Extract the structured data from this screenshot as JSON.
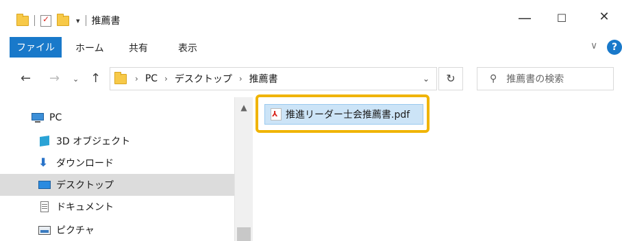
{
  "window": {
    "title": "推薦書",
    "controls": {
      "minimize": "—",
      "maximize": "☐",
      "close": "✕"
    }
  },
  "ribbon": {
    "tabs": [
      "ファイル",
      "ホーム",
      "共有",
      "表示"
    ],
    "help": "?"
  },
  "address": {
    "crumbs": [
      "PC",
      "デスクトップ",
      "推薦書"
    ],
    "search_placeholder": "推薦書の検索"
  },
  "nav_pane": {
    "items": [
      {
        "label": "PC",
        "icon": "pc-icon"
      },
      {
        "label": "3D オブジェクト",
        "icon": "3d-objects-icon"
      },
      {
        "label": "ダウンロード",
        "icon": "download-icon"
      },
      {
        "label": "デスクトップ",
        "icon": "desktop-icon",
        "selected": true
      },
      {
        "label": "ドキュメント",
        "icon": "documents-icon"
      },
      {
        "label": "ピクチャ",
        "icon": "pictures-icon"
      }
    ]
  },
  "files": [
    {
      "name": "推進リーダー士会推薦書.pdf",
      "icon": "pdf-file-icon",
      "selected": true
    }
  ],
  "colors": {
    "accent": "#1979ca",
    "selection": "#cce4f7",
    "highlight_border": "#f0b400"
  }
}
